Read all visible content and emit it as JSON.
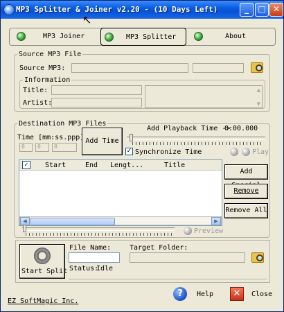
{
  "window": {
    "title": "MP3 Splitter & Joiner v2.20 - (10 Days Left)",
    "minimize": "_",
    "maximize": "□",
    "close": "✕"
  },
  "tabs": [
    {
      "label": "MP3 Joiner"
    },
    {
      "label": "MP3 Splitter"
    },
    {
      "label": "About"
    }
  ],
  "source": {
    "legend": "Source MP3 File",
    "label": "Source MP3:",
    "value": "",
    "info_legend": "Information",
    "title_label": "Title:",
    "artist_label": "Artist:"
  },
  "destination": {
    "legend": "Destination MP3 Files",
    "time_label": "Time [mm:ss.ppp]:",
    "time_mm": "0",
    "time_ss": "0",
    "time_ppp": "0",
    "add_time": "Add Time",
    "add_playback": "Add Playback Time ->",
    "playback_time": "0:00.000",
    "sync_label": "Synchronize Time",
    "play_label": "Play",
    "columns": [
      "Start",
      "End",
      "Lengt...",
      "Title"
    ],
    "add_special": "Add Special",
    "remove": "Remove",
    "remove_all": "Remove All",
    "preview": "Preview"
  },
  "bottom": {
    "start_split": "Start Split",
    "file_name_label": "File Name:",
    "target_folder_label": "Target Folder:",
    "status_label": "Status:",
    "status_value": "Idle"
  },
  "footer": {
    "company": "EZ SoftMagic Inc.",
    "help": "Help",
    "close": "Close"
  }
}
